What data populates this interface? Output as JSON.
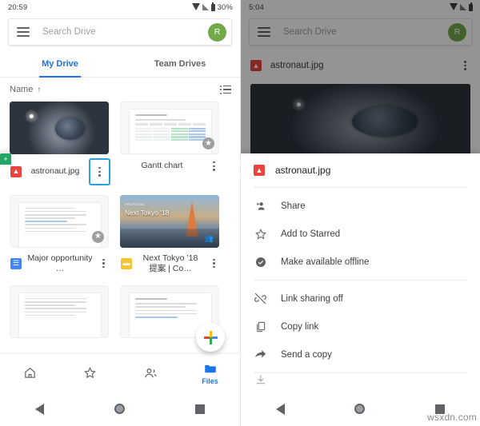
{
  "left": {
    "status": {
      "time": "20:59",
      "battery": "30%",
      "icons": [
        "wifi-icon",
        "signal-icon",
        "battery-icon"
      ]
    },
    "search": {
      "placeholder": "Search Drive",
      "menu_icon": "hamburger-icon",
      "avatar_initial": "R"
    },
    "tabs": [
      {
        "label": "My Drive",
        "active": true
      },
      {
        "label": "Team Drives",
        "active": false
      }
    ],
    "sort": {
      "label": "Name",
      "direction": "↑",
      "view_icon": "list-view-icon"
    },
    "files": [
      {
        "name": "astronaut.jpg",
        "type": "img",
        "thumb": "astronaut-photo",
        "starred": false,
        "menu_highlighted": true
      },
      {
        "name": "Gantt chart",
        "type": "sheet",
        "thumb": "spreadsheet-doc",
        "starred": true,
        "menu_highlighted": false
      },
      {
        "name": "Major opportunity …",
        "type": "doc",
        "thumb": "text-doc",
        "starred": true,
        "menu_highlighted": false
      },
      {
        "name": "Next Tokyo ’18 提案 | Co…",
        "type": "slide",
        "thumb": "tokyo-photo",
        "starred": false,
        "menu_highlighted": false
      }
    ],
    "tokyo_thumb": {
      "title": "Next Tokyo '18",
      "subtitle": "PROPOSAL"
    },
    "fab": {
      "label": "create-new",
      "icon": "google-plus-icon"
    },
    "bottom_nav": [
      {
        "label": "Home",
        "icon": "home-icon",
        "active": false,
        "show_label": false
      },
      {
        "label": "Starred",
        "icon": "star-icon",
        "active": false,
        "show_label": false
      },
      {
        "label": "Shared",
        "icon": "people-icon",
        "active": false,
        "show_label": false
      },
      {
        "label": "Files",
        "icon": "folder-icon",
        "active": true,
        "show_label": true
      }
    ]
  },
  "right": {
    "status": {
      "time": "5:04",
      "battery": "",
      "icons": [
        "wifi-icon",
        "signal-icon",
        "battery-icon"
      ]
    },
    "search": {
      "placeholder": "Search Drive",
      "menu_icon": "hamburger-icon",
      "avatar_initial": "R"
    },
    "background_item": {
      "name": "astronaut.jpg",
      "type": "img",
      "overflow_icon": "kebab-icon"
    },
    "sheet": {
      "title": "astronaut.jpg",
      "title_type": "img",
      "groups": [
        {
          "items": [
            {
              "label": "Share",
              "icon": "person-add-icon"
            },
            {
              "label": "Add to Starred",
              "icon": "star-outline-icon"
            },
            {
              "label": "Make available offline",
              "icon": "offline-check-icon"
            }
          ]
        },
        {
          "items": [
            {
              "label": "Link sharing off",
              "icon": "link-off-icon"
            },
            {
              "label": "Copy link",
              "icon": "copy-icon"
            },
            {
              "label": "Send a copy",
              "icon": "send-arrow-icon"
            }
          ]
        }
      ]
    }
  },
  "sysnav": {
    "back": "back-icon",
    "home": "home-circle-icon",
    "recents": "recents-square-icon"
  },
  "watermark": "wsxdn.com",
  "colors": {
    "accent": "#1a73e8",
    "highlight": "#29a3dc",
    "avatar": "#74a94a",
    "image_red": "#e8453c",
    "sheet_green": "#23a566",
    "doc_blue": "#4285f4",
    "slide_yellow": "#f7c32e"
  }
}
